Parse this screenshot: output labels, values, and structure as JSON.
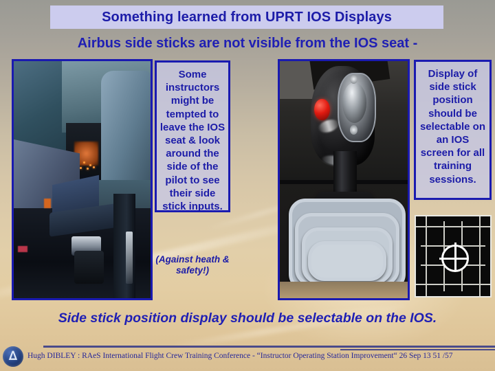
{
  "slide": {
    "title": "Something learned from UPRT IOS Displays",
    "subtitle": "Airbus side sticks are not visible from the IOS seat -",
    "bottom_headline": "Side stick position display should be selectable on the IOS.",
    "accent_color": "#1c1ca8",
    "title_band_color": "#ccccee"
  },
  "callouts": {
    "center": "Some instructors might be tempted to leave the IOS seat & look around the side of the pilot to see their side stick inputs.",
    "center_note": "(Against heath & safety!)",
    "right": "Display of side stick position should be selectable on an IOS screen for all training sessions."
  },
  "images": {
    "left": "cockpit-interior-photo",
    "center": "airbus-side-stick-photo",
    "grid": "side-stick-position-display"
  },
  "footer": {
    "logo": "raes-logo-icon",
    "text": "Hugh DIBLEY :  RAeS International Flight Crew Training Conference  - “Instructor Operating Station Improvement“  26 Sep 13   51 /57"
  }
}
